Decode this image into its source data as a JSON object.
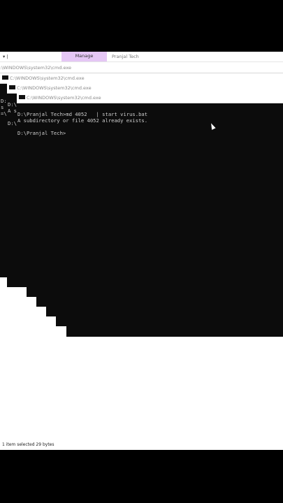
{
  "explorer": {
    "quick_access": "▾ |",
    "manage_tab": "Manage",
    "window_title": "Pranjal Tech",
    "status_text": "1 item selected  29 bytes"
  },
  "windows": [
    {
      "title": ":\\WINDOWS\\system32\\cmd.exe",
      "lines": [
        "",
        "",
        "",
        "",
        "",
        "",
        ""
      ]
    },
    {
      "title": "C:\\WINDOWS\\system32\\cmd.exe",
      "lines": [
        "D:\\",
        "s",
        "=\\",
        "",
        ""
      ]
    },
    {
      "title": "C:\\WINDOWS\\system32\\cmd.exe",
      "lines": [
        "D:\\",
        "A s",
        "",
        "D:\\"
      ]
    },
    {
      "title": "C:\\WINDOWS\\system32\\cmd.exe",
      "lines": [
        "",
        "D:\\Pranjal Tech>md 4052   | start virus.bat",
        "A subdirectory or file 4052 already exists.",
        "",
        "D:\\Pranjal Tech>"
      ]
    }
  ],
  "fragments": {
    "left_edge": "vor"
  },
  "colors": {
    "console_bg": "#0c0c0c",
    "manage_accent": "#e5c7f5"
  },
  "icons": [
    "cmd-icon",
    "mouse-cursor-icon"
  ]
}
